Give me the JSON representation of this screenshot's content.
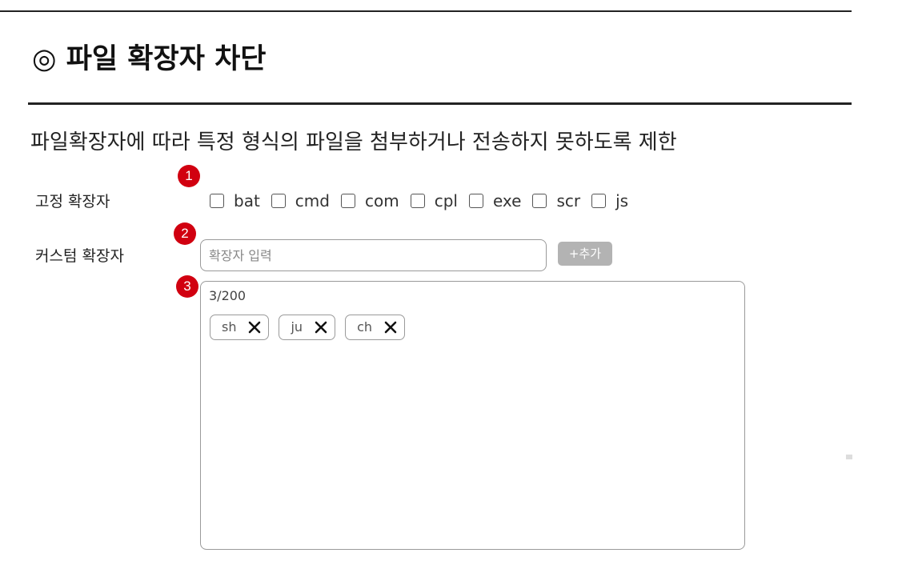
{
  "header": {
    "title": "◎ 파일 확장자 차단",
    "description": "파일확장자에 따라 특정 형식의 파일을 첨부하거나 전송하지 못하도록 제한"
  },
  "markers": [
    "1",
    "2",
    "3"
  ],
  "fixed_extensions": {
    "label": "고정 확장자",
    "options": [
      {
        "label": "bat",
        "checked": false
      },
      {
        "label": "cmd",
        "checked": false
      },
      {
        "label": "com",
        "checked": false
      },
      {
        "label": "cpl",
        "checked": false
      },
      {
        "label": "exe",
        "checked": false
      },
      {
        "label": "scr",
        "checked": false
      },
      {
        "label": "js",
        "checked": false
      }
    ]
  },
  "custom_extensions": {
    "label": "커스텀 확장자",
    "input_value": "",
    "input_placeholder": "확장자 입력",
    "add_label": "+추가",
    "count": "3/200",
    "tags": [
      "sh",
      "ju",
      "ch"
    ]
  },
  "colors": {
    "marker": "#d10010",
    "add_button": "#b3b3b3",
    "border": "#9a9a9a",
    "rule": "#222222"
  },
  "icons": {
    "tag_remove": "close-icon"
  }
}
